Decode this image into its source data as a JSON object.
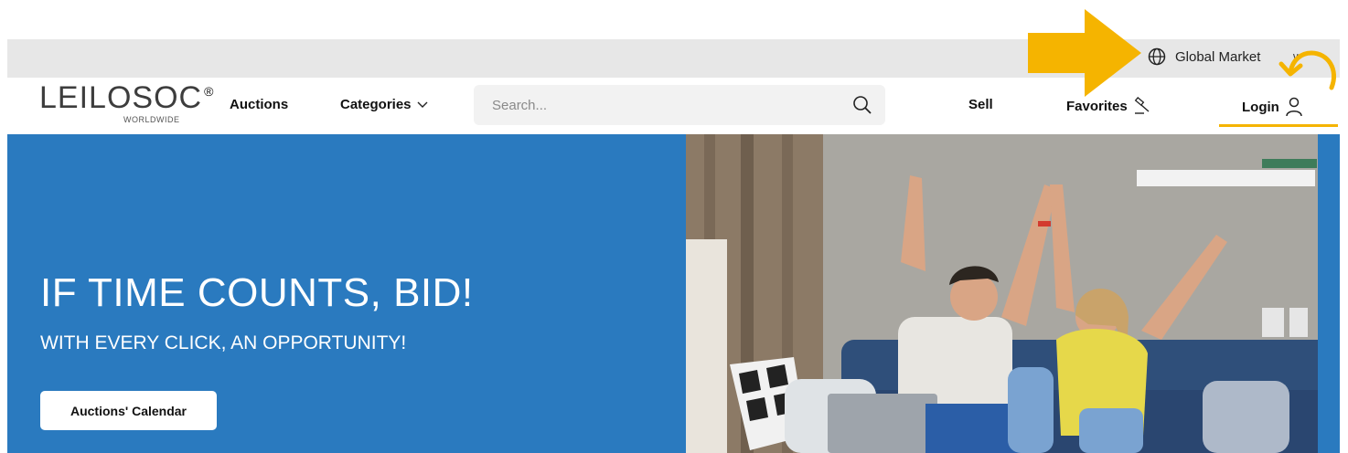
{
  "header": {
    "market_label": "Global Market",
    "logo_text": "LEILOSOC",
    "logo_mark": "®",
    "logo_subtitle": "WORLDWIDE",
    "nav": {
      "auctions": "Auctions",
      "categories": "Categories",
      "sell": "Sell",
      "favorites": "Favorites",
      "login": "Login"
    },
    "search": {
      "placeholder": "Search..."
    }
  },
  "hero": {
    "title": "IF TIME COUNTS, BID!",
    "subtitle": "WITH EVERY CLICK, AN OPPORTUNITY!",
    "cta_label": "Auctions' Calendar",
    "image_alt": "Couple cheering on a sofa"
  },
  "icons": [
    "globe-icon",
    "chevron-down-icon",
    "search-icon",
    "gavel-icon",
    "user-icon",
    "arrow-annotation-icon",
    "undo-annotation-icon"
  ],
  "colors": {
    "hero_blue": "#2a7abf",
    "annotation_yellow": "#f5b400",
    "topbar_gray": "#e7e7e7"
  }
}
